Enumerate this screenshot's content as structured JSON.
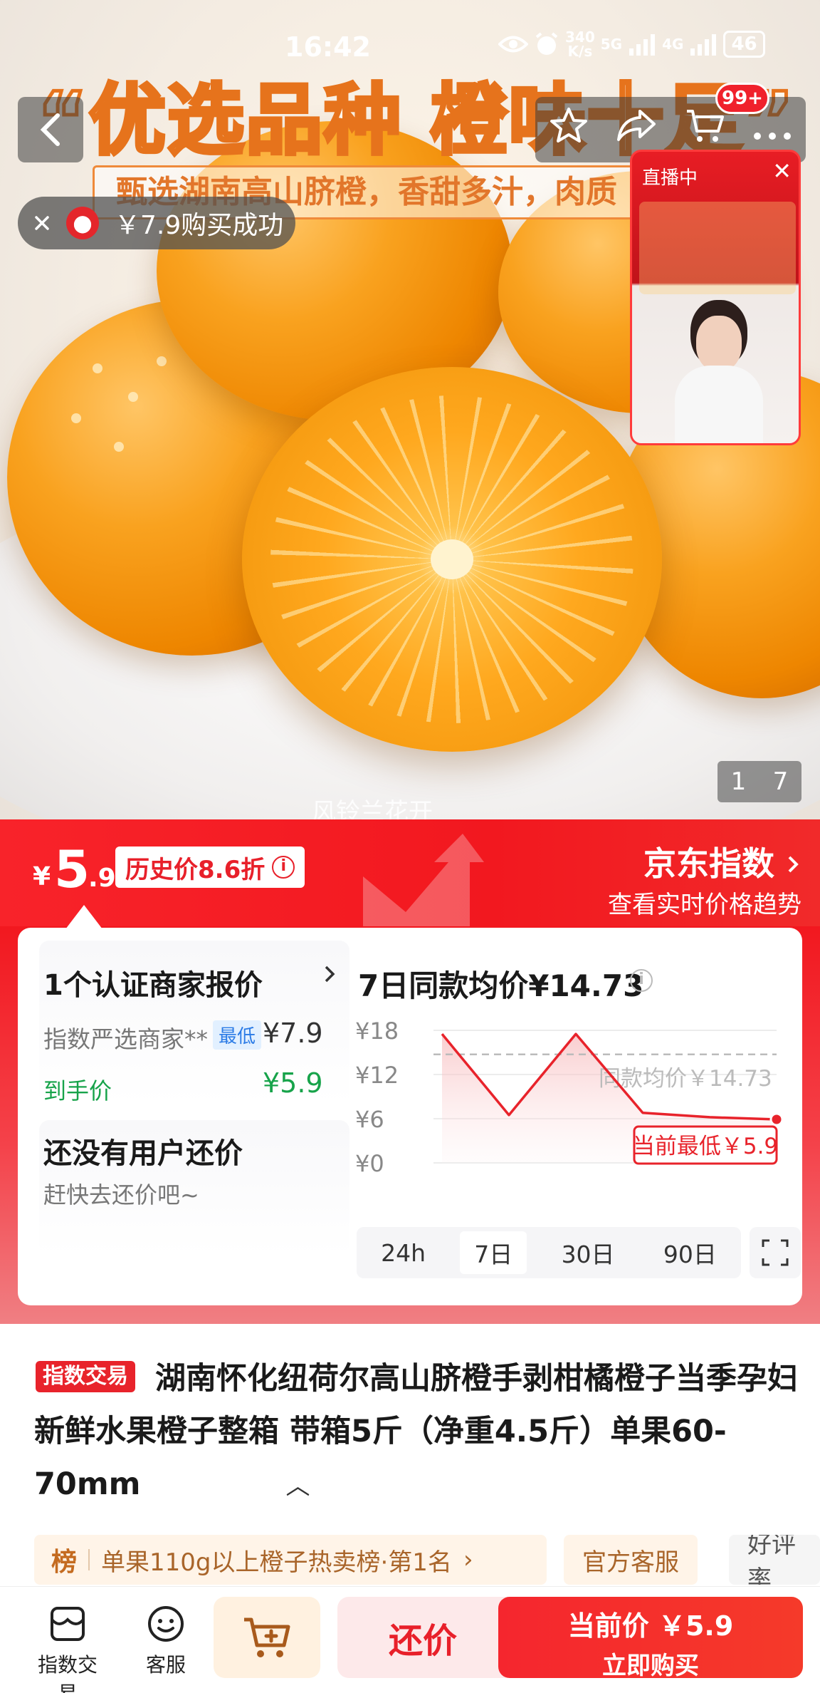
{
  "status_bar": {
    "time": "16:42",
    "net_speed": "340",
    "net_unit": "K/s",
    "net_type": "5G",
    "net_type_2": "4G",
    "battery": "46"
  },
  "hero": {
    "headline": "“优选品种 橙味十足”",
    "subline": "甄选湖南高山脐橙，香甜多汁，肉质",
    "page_current": "1",
    "page_total": "7",
    "watermark": "风铃兰花开"
  },
  "header": {
    "cart_badge": "99+"
  },
  "toast": {
    "text": "￥7.9购买成功"
  },
  "live": {
    "tag": "直播中"
  },
  "price": {
    "currency": "¥",
    "integer": "5",
    "decimal": ".9",
    "history_tag": "历史价8.6折",
    "index_title": "京东指数",
    "index_sub": "查看实时价格趋势"
  },
  "merchant": {
    "title": "1个认证商家报价",
    "seller": "指数严选商家**",
    "lowest_tag": "最低",
    "seller_price": "¥7.9",
    "hand_price_label": "到手价",
    "hand_price": "¥5.9"
  },
  "bargain": {
    "title": "还没有用户还价",
    "subtitle": "赶快去还价吧~"
  },
  "chart_data": {
    "type": "line",
    "title": "7日同款均价¥14.73",
    "y_ticks": [
      "¥18",
      "¥12",
      "¥6",
      "¥0"
    ],
    "ylim": [
      0,
      18
    ],
    "values": [
      17.5,
      6.5,
      17.5,
      6.8,
      6.2,
      5.9
    ],
    "average": 14.73,
    "average_label": "同款均价￥14.73",
    "current_label": "当前最低￥5.9",
    "ranges": [
      "24h",
      "7日",
      "30日",
      "90日"
    ],
    "active_range": "7日",
    "colors": {
      "line": "#e8232b",
      "average": "#bbbbbb"
    }
  },
  "product": {
    "tag": "指数交易",
    "title": "湖南怀化纽荷尔高山脐橙手剥柑橘橙子当季孕妇新鲜水果橙子整箱 带箱5斤（净重4.5斤）单果60-70mm",
    "rank_badge": "榜",
    "rank_text": "单果110g以上橙子热卖榜·第1名",
    "service_tag": "官方客服",
    "review_tag": "好评率"
  },
  "bottom": {
    "trade_label": "指数交易",
    "service_label": "客服",
    "bargain_label": "还价",
    "buy_price": "当前价 ￥5.9",
    "buy_label": "立即购买"
  },
  "colors": {
    "brand_red": "#f2181f",
    "green": "#17a34a",
    "gold": "#a9652a"
  }
}
